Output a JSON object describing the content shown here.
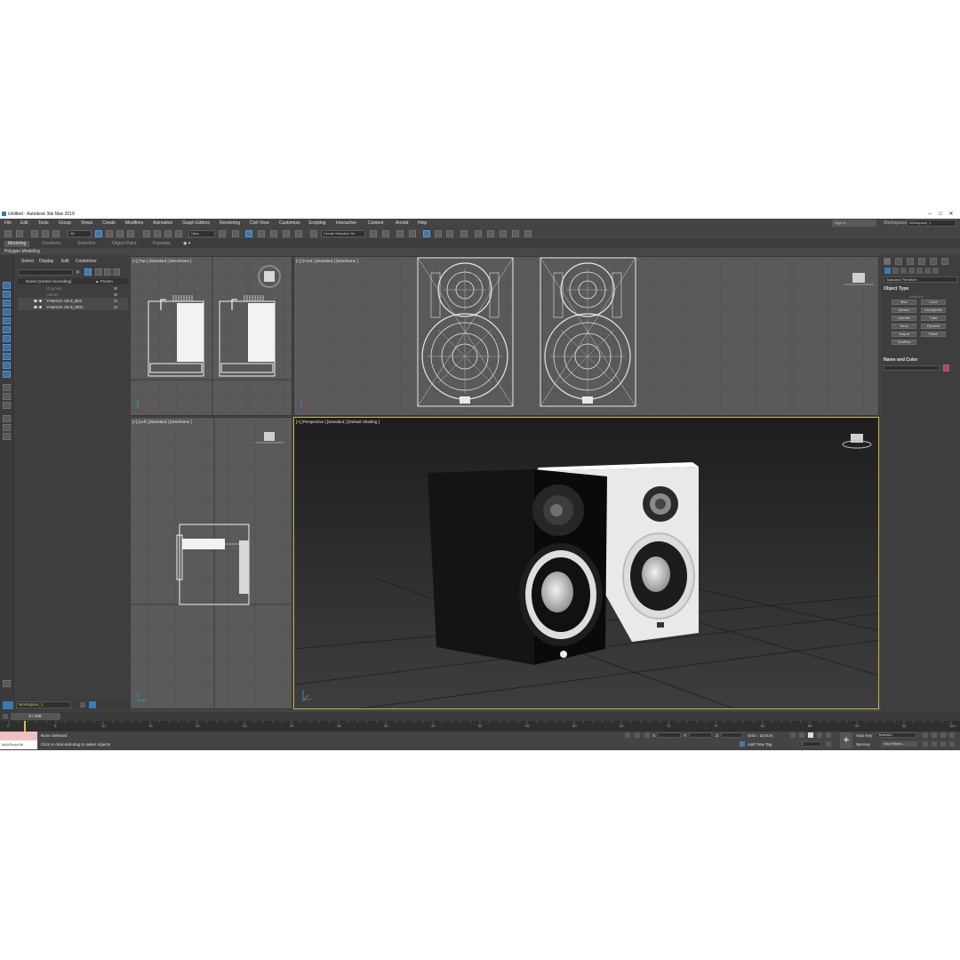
{
  "window": {
    "title": "Untitled - Autodesk 3ds Max 2019",
    "controls": [
      "–",
      "□",
      "✕"
    ]
  },
  "menus": [
    "File",
    "Edit",
    "Tools",
    "Group",
    "Views",
    "Create",
    "Modifiers",
    "Animation",
    "Graph Editors",
    "Rendering",
    "Civil View",
    "Customize",
    "Scripting",
    "Interactive",
    "Content",
    "Arnold",
    "Help"
  ],
  "account": {
    "sign_in": "Sign In",
    "workspaces_label": "Workspaces:",
    "workspace_value": "Workspace_1"
  },
  "toolbar": {
    "filter_value": "All",
    "view_value": "View",
    "selection_set_placeholder": "Create Selection Se"
  },
  "ribbon": {
    "tabs": [
      "Modeling",
      "Freeform",
      "Selection",
      "Object Paint",
      "Populate"
    ],
    "active_tab": "Modeling",
    "subpanel": "Polygon Modeling"
  },
  "explorer": {
    "menus": [
      "Select",
      "Display",
      "Edit",
      "Customize"
    ],
    "header_name": "Name (Sorted Ascending)",
    "header_frozen": "▲ Frozen",
    "rows": [
      "(Cuyma)",
      "(Janie)",
      "YAMAHA HS 8_B01",
      "YAMAHA HS 8_W01"
    ]
  },
  "viewports": {
    "top": "[+] [Top ] [Standard ] [Wireframe ]",
    "front": "[+] [Front ] [Standard ] [Wireframe ]",
    "left": "[+] [Left ] [Standard ] [Wireframe ]",
    "perspective": "[+] [Perspective ] [Standard ] [Default Shading ]"
  },
  "command_panel": {
    "category": "Standard Primitives",
    "rollout_object_type": "Object Type",
    "autogrid": "AutoGrid",
    "primitives": [
      "Box",
      "Cone",
      "Sphere",
      "GeoSphere",
      "Cylinder",
      "Tube",
      "Torus",
      "Pyramid",
      "Teapot",
      "Plane",
      "TextPlus"
    ],
    "rollout_name_color": "Name and Color",
    "object_color": "#d6337a"
  },
  "bottom": {
    "workspace_field": "Workspace_1",
    "time_slider": "0 / 100",
    "ticks": [
      "0",
      "5",
      "10",
      "15",
      "20",
      "25",
      "30",
      "35",
      "40",
      "45",
      "50",
      "55",
      "60",
      "65",
      "70",
      "75",
      "80",
      "85",
      "90",
      "95",
      "100"
    ],
    "maxscript_label": "MAXScript Mi",
    "status_selected": "None Selected",
    "status_prompt": "Click or click-and-drag to select objects",
    "coord_x_label": "X:",
    "coord_y_label": "Y:",
    "coord_z_label": "Z:",
    "grid_text": "Grid = 10,0cm",
    "add_time_tag": "Add Time Tag",
    "auto_key": "Auto Key",
    "set_key": "Set Key",
    "key_mode_value": "Selected",
    "key_filters": "Key Filters...",
    "frame_value": "0"
  },
  "colors": {
    "ui_bg": "#444444",
    "viewport_bg": "#5a5a5a",
    "accent_blue": "#3c79b8",
    "active_viewport_border": "#c8b43c"
  }
}
